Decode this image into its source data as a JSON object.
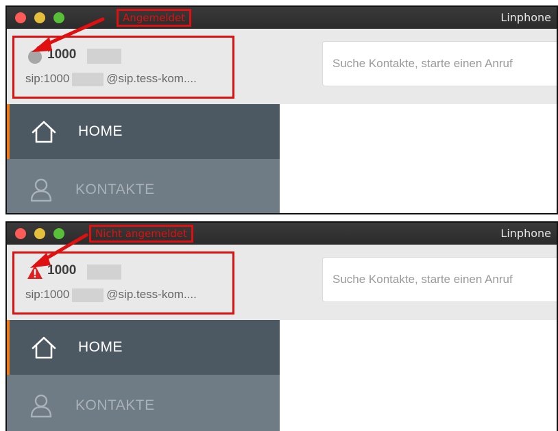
{
  "app": {
    "window_title": "Linphone"
  },
  "colors": {
    "annotation": "#e01010",
    "sidebar_active": "#4d5962",
    "sidebar_inactive": "#6f7b85",
    "active_indicator": "#f07a12",
    "status_offline": "#a6a6a6",
    "warning": "#e02020"
  },
  "panels": [
    {
      "annotation_label": "Angemeldet",
      "account": {
        "name": "1000",
        "status_icon": "grey-status-dot",
        "uri_prefix": "sip:1000",
        "uri_suffix": "@sip.tess-kom...."
      },
      "search": {
        "placeholder": "Suche Kontakte, starte einen Anruf"
      },
      "sidebar": [
        {
          "label": "HOME",
          "icon": "home-icon"
        },
        {
          "label": "KONTAKTE",
          "icon": "contacts-icon"
        }
      ]
    },
    {
      "annotation_label": "Nicht angemeldet",
      "account": {
        "name": "1000",
        "status_icon": "warning-icon",
        "uri_prefix": "sip:1000",
        "uri_suffix": "@sip.tess-kom...."
      },
      "search": {
        "placeholder": "Suche Kontakte, starte einen Anruf"
      },
      "sidebar": [
        {
          "label": "HOME",
          "icon": "home-icon"
        },
        {
          "label": "KONTAKTE",
          "icon": "contacts-icon"
        }
      ]
    }
  ]
}
